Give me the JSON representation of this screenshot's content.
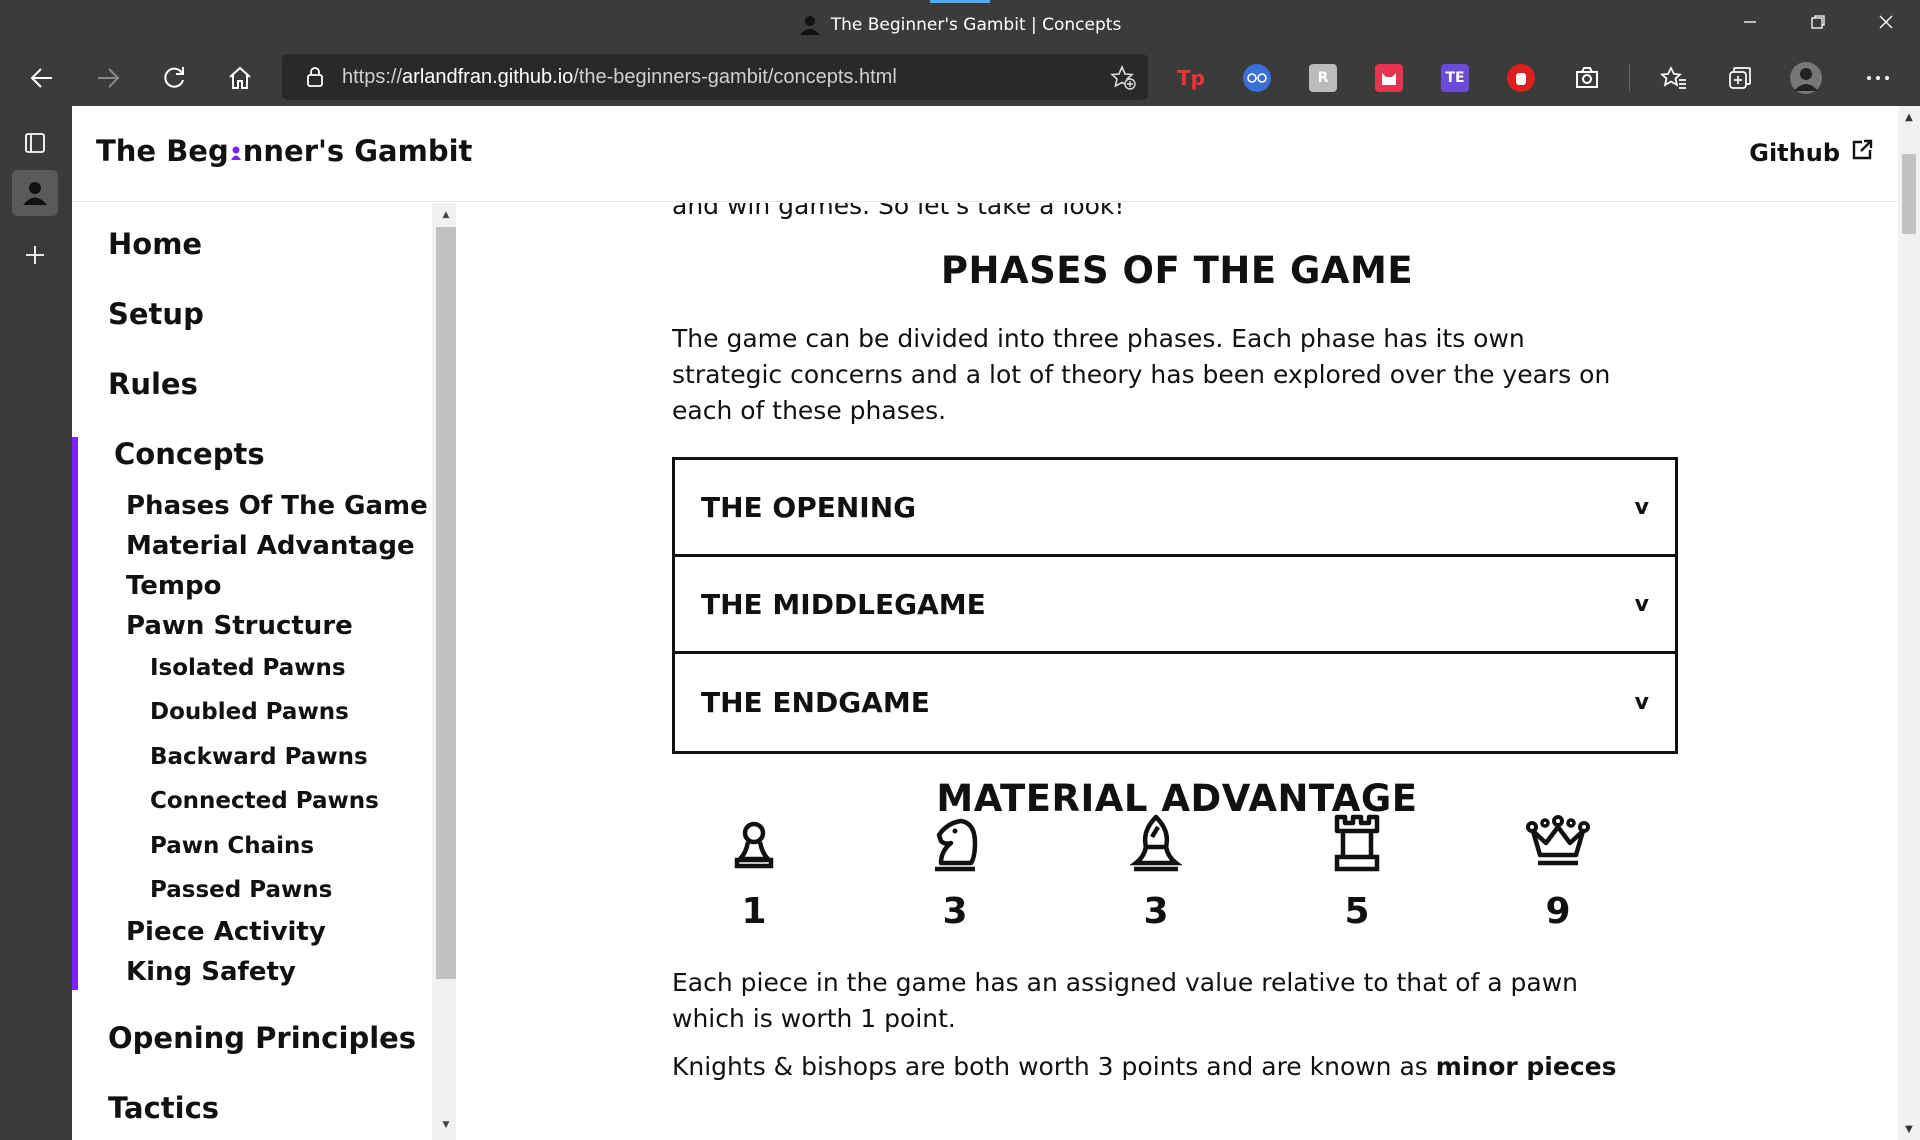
{
  "browser": {
    "tab_title": "The Beginner's Gambit | Concepts",
    "url_prefix": "https://",
    "url_host": "arlandfran.github.io",
    "url_path": "/the-beginners-gambit/concepts.html"
  },
  "site": {
    "logo_part1": "The Beg",
    "logo_part2": "nner's Gambit",
    "github_label": "Github"
  },
  "sidebar": {
    "home": "Home",
    "setup": "Setup",
    "rules": "Rules",
    "concepts": "Concepts",
    "sub": [
      "Phases Of The Game",
      "Material Advantage",
      "Tempo",
      "Pawn Structure"
    ],
    "pawn_sub": [
      "Isolated Pawns",
      "Doubled Pawns",
      "Backward Pawns",
      "Connected Pawns",
      "Pawn Chains",
      "Passed Pawns"
    ],
    "sub2": [
      "Piece Activity",
      "King Safety"
    ],
    "opening_principles": "Opening Principles",
    "tactics": "Tactics"
  },
  "main": {
    "cut_text": "and win games. So let's take a look!",
    "phases_heading": "PHASES OF THE GAME",
    "phases_intro": "The game can be divided into three phases. Each phase has its own strategic concerns and a lot of theory has been explored over the years on each of these phases.",
    "accordion": [
      {
        "label": "THE OPENING",
        "chevron": "v"
      },
      {
        "label": "THE MIDDLEGAME",
        "chevron": "v"
      },
      {
        "label": "THE ENDGAME",
        "chevron": "v"
      }
    ],
    "material_heading": "MATERIAL ADVANTAGE",
    "pieces": [
      {
        "icon": "pawn-icon",
        "value": "1"
      },
      {
        "icon": "knight-icon",
        "value": "3"
      },
      {
        "icon": "bishop-icon",
        "value": "3"
      },
      {
        "icon": "rook-icon",
        "value": "5"
      },
      {
        "icon": "queen-icon",
        "value": "9"
      }
    ],
    "value_text": "Each piece in the game has an assigned value relative to that of a pawn which is worth 1 point.",
    "minor_text_start": "Knights & bishops are both worth 3 points and are known as ",
    "minor_text_bold": "minor pieces"
  },
  "colors": {
    "accent": "#7b22ff",
    "chrome": "#3b3b3b"
  }
}
